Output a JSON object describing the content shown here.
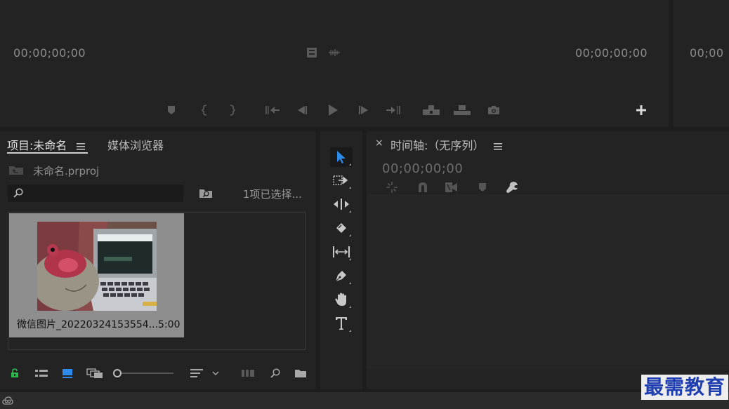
{
  "source_monitor": {
    "timecode_in": "00;00;00;00",
    "timecode_out": "00;00;00;00"
  },
  "program_monitor": {
    "timecode_in": "00;00"
  },
  "project_panel": {
    "tab_project": "项目:未命名",
    "tab_media_browser": "媒体浏览器",
    "project_file": "未命名.prproj",
    "search_placeholder": "",
    "selection_status": "1项已选择...",
    "clip_name": "微信图片_20220324153554...5:00"
  },
  "timeline_panel": {
    "close": "×",
    "tab_title": "时间轴:（无序列）",
    "timecode": "00;00;00;00"
  },
  "watermark": "最需教育",
  "colors": {
    "accent_blue": "#2d8ceb",
    "lock_green": "#2db84d",
    "watermark": "#1f3fb0"
  }
}
